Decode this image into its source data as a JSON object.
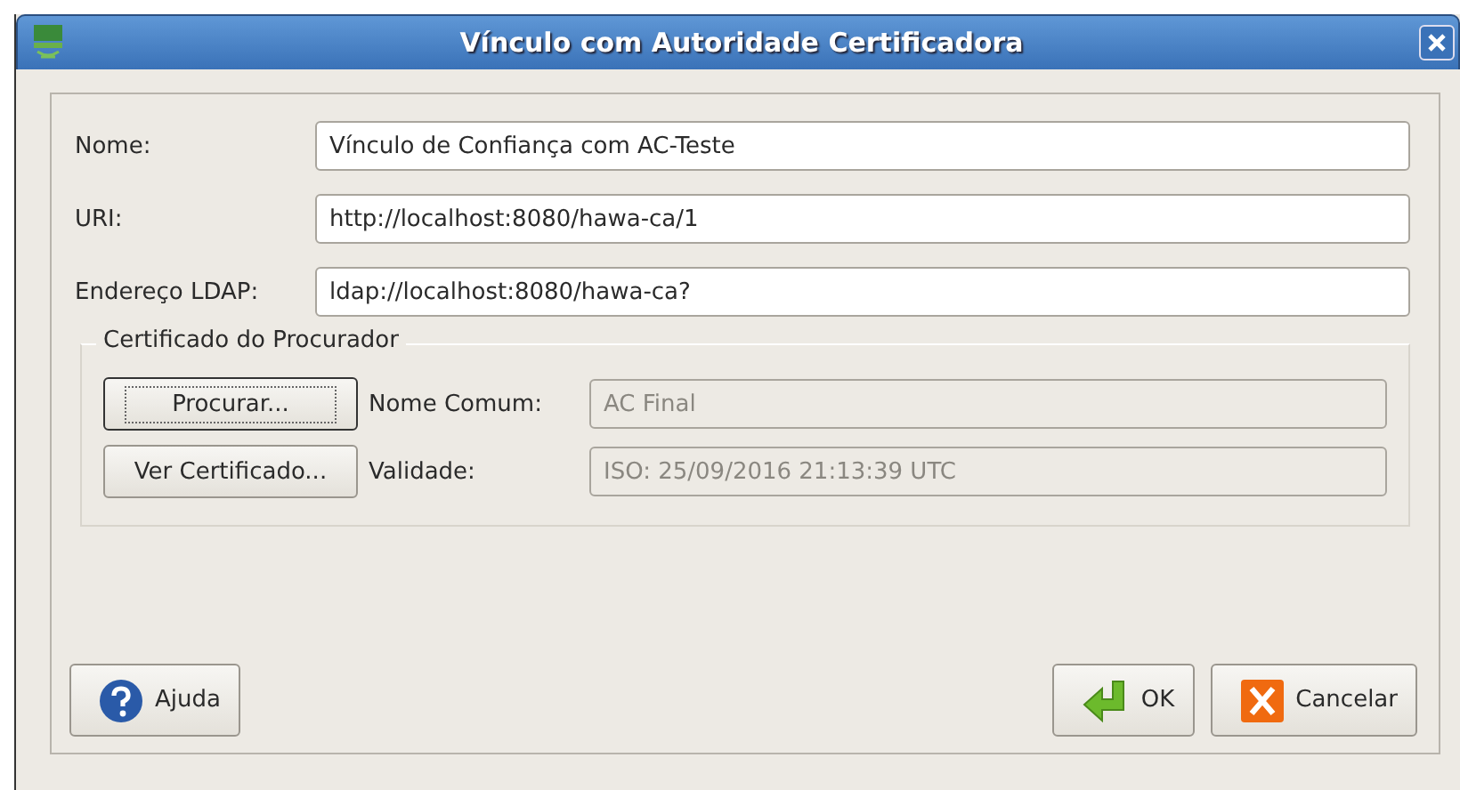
{
  "window": {
    "title": "Vínculo com Autoridade Certificadora"
  },
  "fields": [
    {
      "label": "Nome:",
      "value": "Vínculo de Confiança com AC-Teste"
    },
    {
      "label": "URI:",
      "value": "http://localhost:8080/hawa-ca/1"
    },
    {
      "label": "Endereço LDAP:",
      "value": "ldap://localhost:8080/hawa-ca?"
    }
  ],
  "group": {
    "title": "Certificado do Procurador",
    "rows": [
      {
        "button": "Procurar...",
        "focused": true,
        "label": "Nome Comum:",
        "value": "AC Final",
        "disabled": true
      },
      {
        "button": "Ver Certificado...",
        "focused": false,
        "label": "Validade:",
        "value": "ISO: 25/09/2016 21:13:39 UTC",
        "disabled": true
      }
    ]
  },
  "buttons": [
    {
      "kind": "help",
      "label": "Ajuda"
    },
    {
      "kind": "ok",
      "label": "OK"
    },
    {
      "kind": "cancel",
      "label": "Cancelar"
    }
  ]
}
